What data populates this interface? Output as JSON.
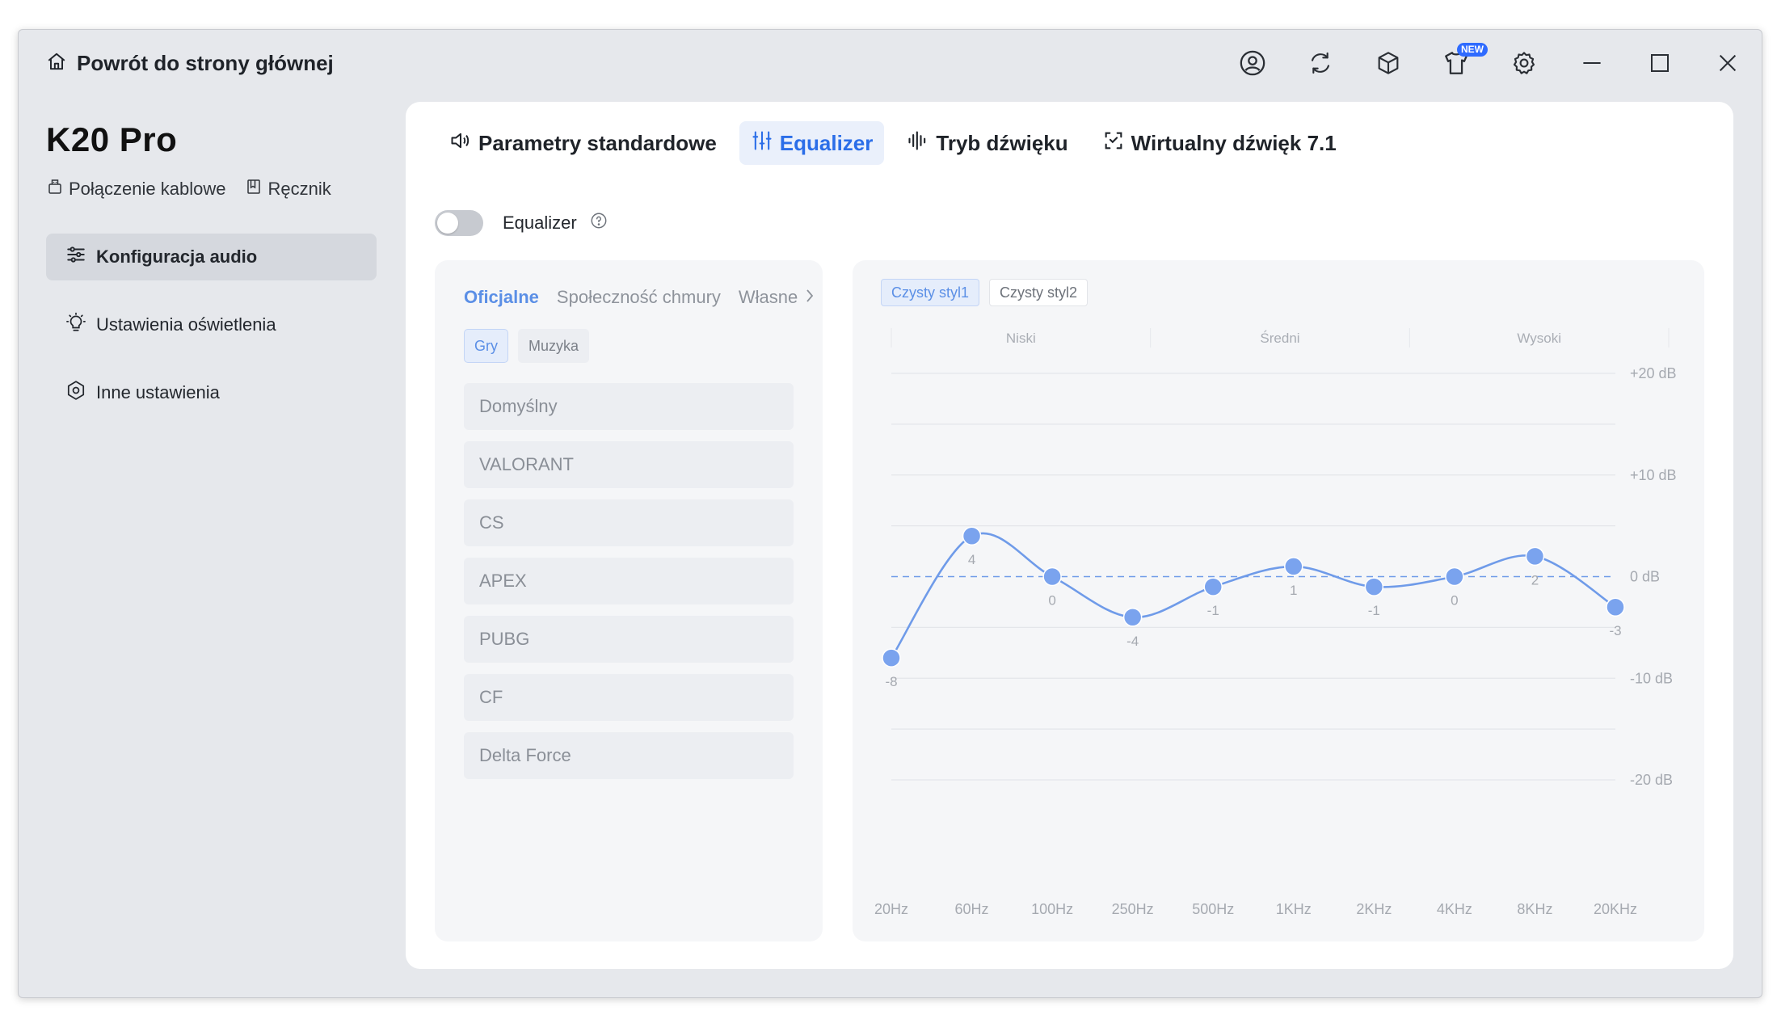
{
  "titlebar": {
    "home_label": "Powrót do strony głównej",
    "icons": [
      "user-icon",
      "refresh-icon",
      "cube-icon",
      "shirt-icon",
      "gear-icon",
      "minimize-icon",
      "maximize-icon",
      "close-icon"
    ],
    "new_badge": "NEW"
  },
  "device": {
    "name": "K20 Pro",
    "connection": "Połączenie kablowe",
    "manual": "Ręcznik"
  },
  "sidebar": {
    "items": [
      {
        "label": "Konfiguracja audio",
        "icon": "sliders-icon",
        "active": true
      },
      {
        "label": "Ustawienia oświetlenia",
        "icon": "bulb-icon",
        "active": false
      },
      {
        "label": "Inne ustawienia",
        "icon": "hexagon-settings-icon",
        "active": false
      }
    ]
  },
  "tabs": [
    {
      "label": "Parametry standardowe",
      "icon": "speaker-icon",
      "active": false
    },
    {
      "label": "Equalizer",
      "icon": "equalizer-icon",
      "active": true
    },
    {
      "label": "Tryb dźwięku",
      "icon": "waveform-icon",
      "active": false
    },
    {
      "label": "Wirtualny dźwięk 7.1",
      "icon": "surround-icon",
      "active": false
    }
  ],
  "equalizer_toggle": {
    "label": "Equalizer",
    "enabled": false
  },
  "presets": {
    "tabs": [
      "Oficjalne",
      "Społeczność chmury",
      "Własne"
    ],
    "active_tab": 0,
    "chips": [
      "Gry",
      "Muzyka"
    ],
    "active_chip": 0,
    "items": [
      "Domyślny",
      "VALORANT",
      "CS",
      "APEX",
      "PUBG",
      "CF",
      "Delta Force"
    ]
  },
  "chart_styles": [
    "Czysty styl1",
    "Czysty styl2"
  ],
  "active_style": 0,
  "chart_data": {
    "type": "line",
    "title": "",
    "bands": [
      "Niski",
      "Średni",
      "Wysoki"
    ],
    "x": [
      "20Hz",
      "60Hz",
      "100Hz",
      "250Hz",
      "500Hz",
      "1KHz",
      "2KHz",
      "4KHz",
      "8KHz",
      "20KHz"
    ],
    "values": [
      -8,
      4,
      0,
      -4,
      -1,
      1,
      -1,
      0,
      2,
      -3
    ],
    "value_labels": [
      "-8",
      "4",
      "0",
      "-4",
      "-1",
      "1",
      "-1",
      "0",
      "2",
      "-3"
    ],
    "y_ticks": [
      "+20 dB",
      "+10 dB",
      "0 dB",
      "-10 dB",
      "-20 dB"
    ],
    "y_tick_values": [
      20,
      10,
      0,
      -10,
      -20
    ],
    "ylim": [
      -20,
      20
    ],
    "grid": true,
    "zero_line": "dashed",
    "colors": {
      "line": "#6f9be9",
      "point": "#7aa3ee",
      "label": "#a5a9b0"
    }
  }
}
